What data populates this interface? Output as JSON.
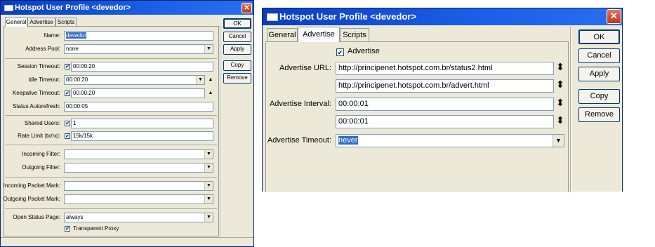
{
  "small_window": {
    "title": "Hotspot User Profile <devedor>",
    "close_glyph": "✕",
    "tabs": [
      "General",
      "Advertise",
      "Scripts"
    ],
    "active_tab": "General",
    "fields": {
      "name": {
        "label": "Name:",
        "value": "devedor"
      },
      "address_pool": {
        "label": "Address Pool:",
        "value": "none"
      },
      "session_timeout": {
        "label": "Session Timeout:",
        "value": "00:00:20"
      },
      "idle_timeout": {
        "label": "Idle Timeout:",
        "value": "00:00:20"
      },
      "keepalive_timeout": {
        "label": "Keepalive Timeout:",
        "value": "00:00:20"
      },
      "status_autorefresh": {
        "label": "Status Autorefresh:",
        "value": "00:00:05"
      },
      "shared_users": {
        "label": "Shared Users:",
        "value": "1"
      },
      "rate_limit": {
        "label": "Rate Limit (tx/rx):",
        "value": "15k/15k"
      },
      "incoming_filter": {
        "label": "Incoming Filter:",
        "value": ""
      },
      "outgoing_filter": {
        "label": "Outgoing Filter:",
        "value": ""
      },
      "incoming_packet_mark": {
        "label": "Incoming Packet Mark:",
        "value": ""
      },
      "outgoing_packet_mark": {
        "label": "Outgoing Packet Mark:",
        "value": ""
      },
      "open_status_page": {
        "label": "Open Status Page:",
        "value": "always"
      },
      "transparent_proxy": {
        "label": "Transparent Proxy",
        "checked": true
      }
    },
    "buttons": {
      "ok": "OK",
      "cancel": "Cancel",
      "apply": "Apply",
      "copy": "Copy",
      "remove": "Remove"
    }
  },
  "big_window": {
    "title": "Hotspot User Profile <devedor>",
    "close_glyph": "✕",
    "tabs": [
      "General",
      "Advertise",
      "Scripts"
    ],
    "active_tab": "Advertise",
    "advertise": {
      "label": "Advertise",
      "checked": true
    },
    "advertise_url": {
      "label": "Advertise URL:",
      "values": [
        "http://principenet.hotspot.com.br/status2.html",
        "http://principenet.hotspot.com.br/advert.html"
      ]
    },
    "advertise_interval": {
      "label": "Advertise Interval:",
      "values": [
        "00:00:01",
        "00:00:01"
      ]
    },
    "advertise_timeout": {
      "label": "Advertise Timeout:",
      "value": "never"
    },
    "buttons": {
      "ok": "OK",
      "cancel": "Cancel",
      "apply": "Apply",
      "copy": "Copy",
      "remove": "Remove"
    }
  },
  "icons": {
    "check": "✔",
    "dropdown": "▼",
    "updown": "⬍",
    "up": "▲"
  },
  "colors": {
    "title_bar": "#0a3ec0",
    "window_bg": "#ece9d8",
    "selection": "#316ac5",
    "close_button": "#c0371c"
  }
}
